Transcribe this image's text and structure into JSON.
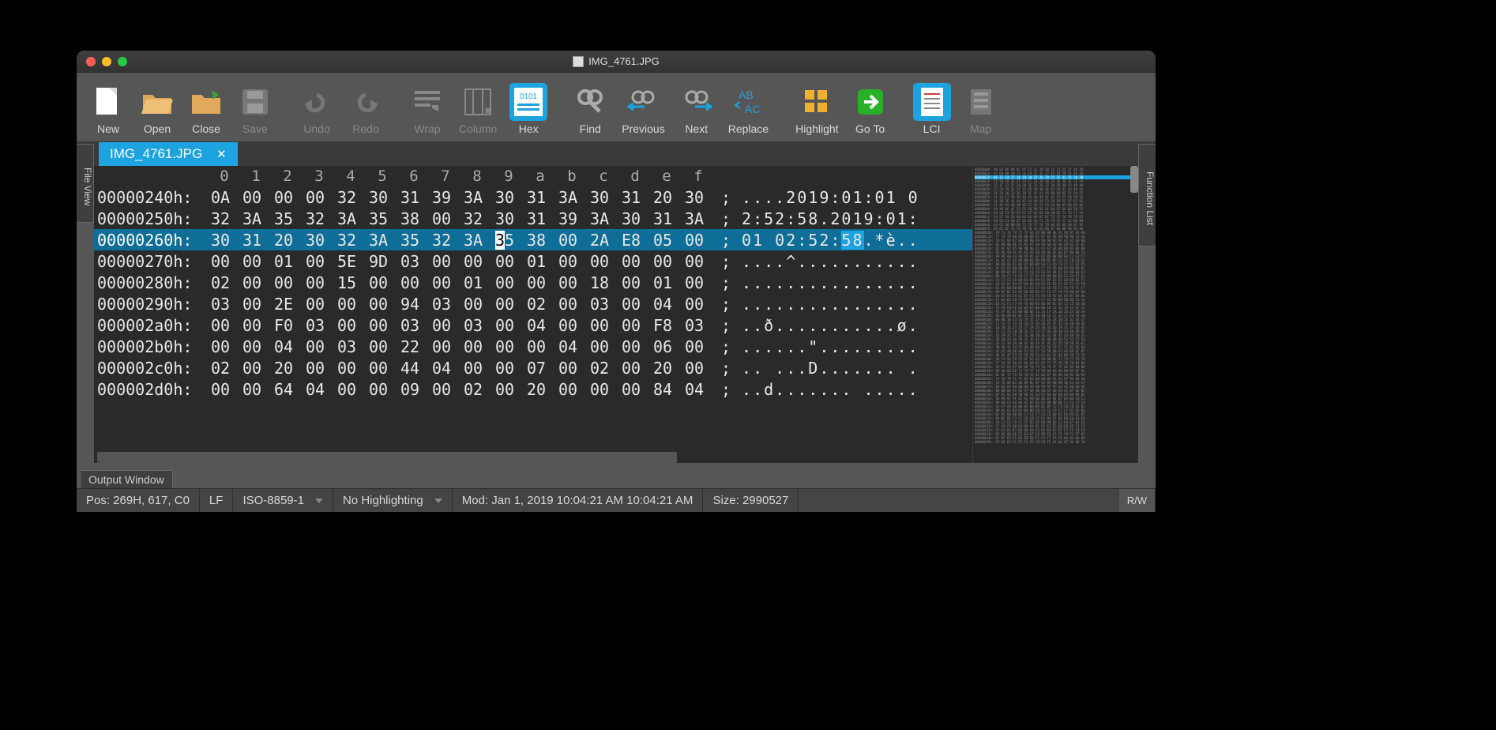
{
  "window": {
    "title": "IMG_4761.JPG"
  },
  "toolbar": {
    "new": "New",
    "open": "Open",
    "close": "Close",
    "save": "Save",
    "undo": "Undo",
    "redo": "Redo",
    "wrap": "Wrap",
    "column": "Column",
    "hex": "Hex",
    "find": "Find",
    "previous": "Previous",
    "next": "Next",
    "replace": "Replace",
    "highlight": "Highlight",
    "goto": "Go To",
    "lci": "LCI",
    "map": "Map"
  },
  "tab": {
    "name": "IMG_4761.JPG"
  },
  "sidebars": {
    "left": "File View",
    "right": "Function List"
  },
  "hex": {
    "columns": [
      "0",
      "1",
      "2",
      "3",
      "4",
      "5",
      "6",
      "7",
      "8",
      "9",
      "a",
      "b",
      "c",
      "d",
      "e",
      "f"
    ],
    "rows": [
      {
        "offset": "00000240h:",
        "bytes": [
          "0A",
          "00",
          "00",
          "00",
          "32",
          "30",
          "31",
          "39",
          "3A",
          "30",
          "31",
          "3A",
          "30",
          "31",
          "20",
          "30"
        ],
        "ascii": "....2019:01:01 0"
      },
      {
        "offset": "00000250h:",
        "bytes": [
          "32",
          "3A",
          "35",
          "32",
          "3A",
          "35",
          "38",
          "00",
          "32",
          "30",
          "31",
          "39",
          "3A",
          "30",
          "31",
          "3A"
        ],
        "ascii": "2:52:58.2019:01:"
      },
      {
        "offset": "00000260h:",
        "bytes": [
          "30",
          "31",
          "20",
          "30",
          "32",
          "3A",
          "35",
          "32",
          "3A",
          "35",
          "38",
          "00",
          "2A",
          "E8",
          "05",
          "00"
        ],
        "ascii": "01 02:52:58.*è..",
        "highlight": true,
        "caret_col": 9,
        "ascii_sel": [
          9,
          11
        ]
      },
      {
        "offset": "00000270h:",
        "bytes": [
          "00",
          "00",
          "01",
          "00",
          "5E",
          "9D",
          "03",
          "00",
          "00",
          "00",
          "01",
          "00",
          "00",
          "00",
          "00",
          "00"
        ],
        "ascii": "....^..........."
      },
      {
        "offset": "00000280h:",
        "bytes": [
          "02",
          "00",
          "00",
          "00",
          "15",
          "00",
          "00",
          "00",
          "01",
          "00",
          "00",
          "00",
          "18",
          "00",
          "01",
          "00"
        ],
        "ascii": "................"
      },
      {
        "offset": "00000290h:",
        "bytes": [
          "03",
          "00",
          "2E",
          "00",
          "00",
          "00",
          "94",
          "03",
          "00",
          "00",
          "02",
          "00",
          "03",
          "00",
          "04",
          "00"
        ],
        "ascii": "................"
      },
      {
        "offset": "000002a0h:",
        "bytes": [
          "00",
          "00",
          "F0",
          "03",
          "00",
          "00",
          "03",
          "00",
          "03",
          "00",
          "04",
          "00",
          "00",
          "00",
          "F8",
          "03"
        ],
        "ascii": "..ð...........ø."
      },
      {
        "offset": "000002b0h:",
        "bytes": [
          "00",
          "00",
          "04",
          "00",
          "03",
          "00",
          "22",
          "00",
          "00",
          "00",
          "00",
          "04",
          "00",
          "00",
          "06",
          "00"
        ],
        "ascii": "......\"........."
      },
      {
        "offset": "000002c0h:",
        "bytes": [
          "02",
          "00",
          "20",
          "00",
          "00",
          "00",
          "44",
          "04",
          "00",
          "00",
          "07",
          "00",
          "02",
          "00",
          "20",
          "00"
        ],
        "ascii": ".. ...D....... ."
      },
      {
        "offset": "000002d0h:",
        "bytes": [
          "00",
          "00",
          "64",
          "04",
          "00",
          "00",
          "09",
          "00",
          "02",
          "00",
          "20",
          "00",
          "00",
          "00",
          "84",
          "04"
        ],
        "ascii": "..d....... ....."
      }
    ]
  },
  "output": {
    "label": "Output Window"
  },
  "status": {
    "pos": "Pos: 269H, 617, C0",
    "eol": "LF",
    "encoding": "ISO-8859-1",
    "highlighting": "No Highlighting",
    "mod": "Mod: Jan 1, 2019 10:04:21 AM 10:04:21 AM",
    "size": "Size: 2990527",
    "rw": "R/W"
  }
}
